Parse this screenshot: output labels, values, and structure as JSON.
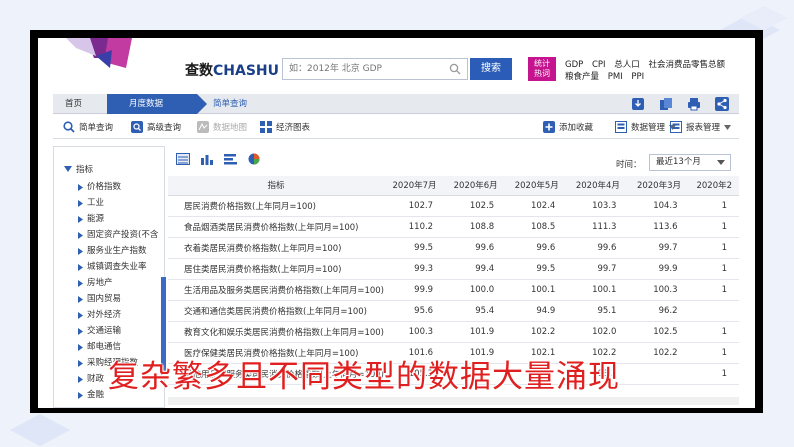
{
  "site": {
    "brand_cn": "查数",
    "brand_en": "CHASHU"
  },
  "search": {
    "placeholder": "如：2012年 北京 GDP",
    "button_label": "搜索"
  },
  "hot": {
    "badge_line1": "统计",
    "badge_line2": "热词",
    "row1": [
      "GDP",
      "CPI",
      "总人口",
      "社会消费品零售总额"
    ],
    "row2": [
      "粮食产量",
      "PMI",
      "PPI"
    ]
  },
  "breadcrumb": {
    "home": "首页",
    "active": "月度数据",
    "sub": "简单查询"
  },
  "tools": {
    "simple": "简单查询",
    "advanced": "高级查询",
    "map": "数据地图",
    "charts": "经济图表",
    "favorite": "添加收藏",
    "data_manage": "数据管理",
    "report_manage": "报表管理"
  },
  "sidebar": {
    "root": "指标",
    "items": [
      "价格指数",
      "工业",
      "能源",
      "固定资产投资(不含",
      "服务业生产指数",
      "城镇调查失业率",
      "房地产",
      "国内贸易",
      "对外经济",
      "交通运输",
      "邮电通信",
      "采购经理指数",
      "财政",
      "金融"
    ]
  },
  "time": {
    "label": "时间：",
    "selected": "最近13个月"
  },
  "table": {
    "headers": [
      "指标",
      "2020年7月",
      "2020年6月",
      "2020年5月",
      "2020年4月",
      "2020年3月",
      "2020年2"
    ],
    "rows": [
      {
        "name": "居民消费价格指数(上年同月=100)",
        "values": [
          "102.7",
          "102.5",
          "102.4",
          "103.3",
          "104.3",
          "1"
        ]
      },
      {
        "name": "食品烟酒类居民消费价格指数(上年同月=100)",
        "values": [
          "110.2",
          "108.8",
          "108.5",
          "111.3",
          "113.6",
          "1"
        ]
      },
      {
        "name": "衣着类居民消费价格指数(上年同月=100)",
        "values": [
          "99.5",
          "99.6",
          "99.6",
          "99.6",
          "99.7",
          "1"
        ]
      },
      {
        "name": "居住类居民消费价格指数(上年同月=100)",
        "values": [
          "99.3",
          "99.4",
          "99.5",
          "99.7",
          "99.9",
          "1"
        ]
      },
      {
        "name": "生活用品及服务类居民消费价格指数(上年同月=100)",
        "values": [
          "99.9",
          "100.0",
          "100.1",
          "100.1",
          "100.3",
          "1"
        ]
      },
      {
        "name": "交通和通信类居民消费价格指数(上年同月=100)",
        "values": [
          "95.6",
          "95.4",
          "94.9",
          "95.1",
          "96.2",
          ""
        ]
      },
      {
        "name": "教育文化和娱乐类居民消费价格指数(上年同月=100)",
        "values": [
          "100.3",
          "101.9",
          "102.2",
          "102.0",
          "102.5",
          "1"
        ]
      },
      {
        "name": "医疗保健类居民消费价格指数(上年同月=100)",
        "values": [
          "101.6",
          "101.9",
          "102.1",
          "102.2",
          "102.2",
          "1"
        ]
      },
      {
        "name": "其他用品和服务类居民消费价格指数(上年同月=100)",
        "values": [
          "105.3",
          "",
          "",
          "103.3",
          "",
          "1"
        ]
      }
    ]
  },
  "overlay_caption": "复杂繁多且不同类型的数据大量涌现",
  "colors": {
    "primary": "#2f5fb3",
    "hot_badge": "#c4158e",
    "caption": "#e02020",
    "frame": "#000000"
  }
}
